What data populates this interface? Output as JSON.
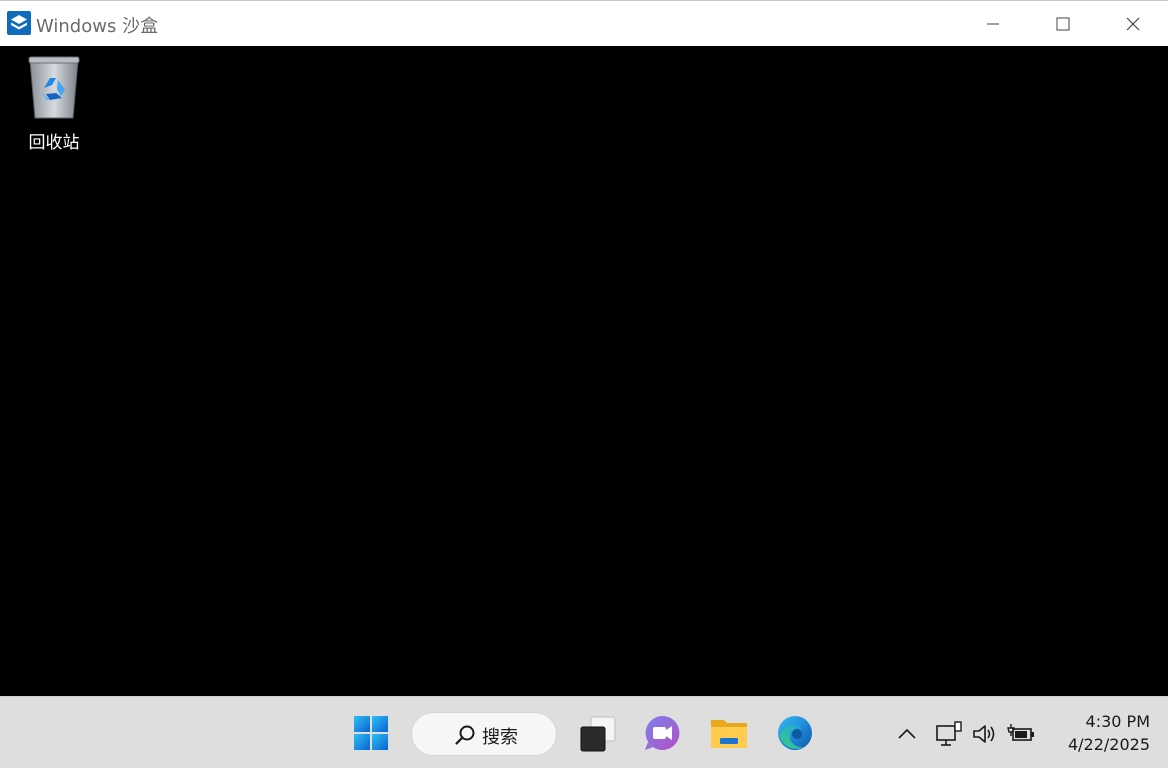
{
  "window": {
    "title": "Windows 沙盒",
    "icon": "sandbox-icon",
    "controls": {
      "minimize": "minimize-icon",
      "maximize": "maximize-icon",
      "close": "close-icon"
    }
  },
  "desktop": {
    "background": "#000000",
    "icons": [
      {
        "label": "回收站",
        "icon": "recycle-bin-icon"
      }
    ]
  },
  "taskbar": {
    "background": "#dedede",
    "items": [
      {
        "name": "start",
        "icon": "windows-start-icon"
      },
      {
        "name": "task-view",
        "icon": "task-view-icon"
      },
      {
        "name": "teams-chat",
        "icon": "teams-chat-icon"
      },
      {
        "name": "file-explorer",
        "icon": "file-explorer-icon"
      },
      {
        "name": "edge",
        "icon": "edge-browser-icon"
      }
    ],
    "search": {
      "label": "搜索",
      "icon": "search-icon"
    },
    "tray": {
      "items": [
        {
          "name": "show-hidden",
          "icon": "chevron-up-icon"
        },
        {
          "name": "network",
          "icon": "network-icon"
        },
        {
          "name": "volume",
          "icon": "volume-icon"
        },
        {
          "name": "battery",
          "icon": "battery-charging-icon"
        }
      ],
      "time": "4:30 PM",
      "date": "4/22/2025"
    }
  }
}
